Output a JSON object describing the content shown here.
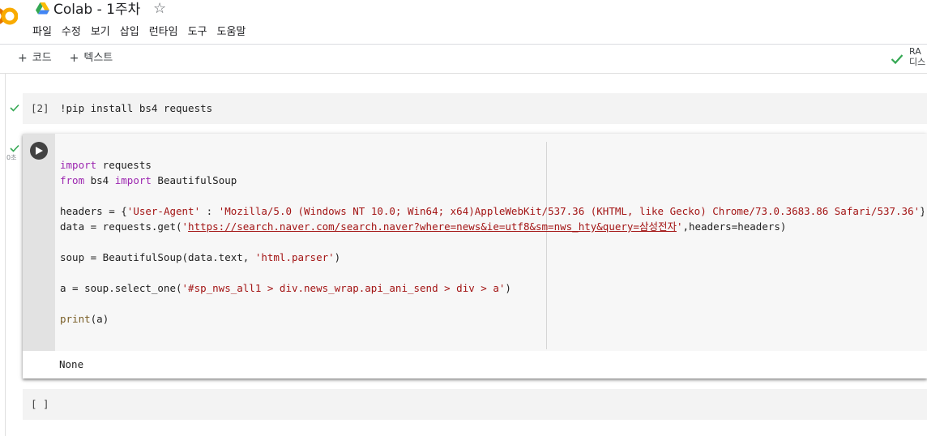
{
  "header": {
    "title": "Colab - 1주차",
    "star": "☆",
    "menu": [
      "파일",
      "수정",
      "보기",
      "삽입",
      "런타임",
      "도구",
      "도움말"
    ]
  },
  "toolbar": {
    "add_code_plus": "+",
    "add_code_label": "코드",
    "add_text_plus": "+",
    "add_text_label": "텍스트",
    "ram_label": "RA",
    "disk_label": "디스"
  },
  "cells": [
    {
      "count": "[2]",
      "code": "!pip install bs4 requests"
    },
    {
      "exec_time": "0초",
      "code": {
        "l1_kw": "import",
        "l1_rest": " requests",
        "l2_kw_from": "from",
        "l2_mid": " bs4 ",
        "l2_kw_import": "import",
        "l2_rest": " BeautifulSoup",
        "l4_pre": "headers = {",
        "l4_key": "'User-Agent'",
        "l4_colon": " : ",
        "l4_val": "'Mozilla/5.0 (Windows NT 10.0; Win64; x64)AppleWebKit/537.36 (KHTML, like Gecko) Chrome/73.0.3683.86 Safari/537.36'",
        "l4_post": "}",
        "l5_pre": "data = requests.get(",
        "l5_q1": "'",
        "l5_url": "https://search.naver.com/search.naver?where=news&ie=utf8&sm=nws_hty&query=삼성전자",
        "l5_q2": "'",
        "l5_post": ",headers=headers)",
        "l7_pre": "soup = BeautifulSoup(data.text, ",
        "l7_str": "'html.parser'",
        "l7_post": ")",
        "l9_pre": "a = soup.select_one(",
        "l9_str": "'#sp_nws_all1 > div.news_wrap.api_ani_send > div > a'",
        "l9_post": ")",
        "l11_fn": "print",
        "l11_rest": "(a)"
      },
      "output": "None"
    },
    {
      "count": "[ ]"
    }
  ],
  "colors": {
    "accent_check": "#34a853",
    "keyword": "#9c27b0",
    "string": "#a31515",
    "logo_orange": "#f9ab00"
  }
}
